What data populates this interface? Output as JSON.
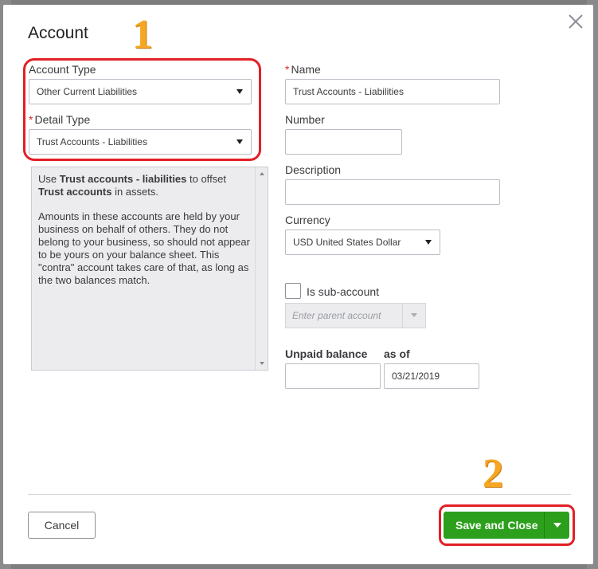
{
  "dialog": {
    "title": "Account",
    "close_icon": "close-icon"
  },
  "annotations": {
    "step1": "1",
    "step2": "2",
    "highlight_color": "#e21f26",
    "number_color": "#f6a623"
  },
  "form": {
    "account_type": {
      "label": "Account Type",
      "value": "Other Current Liabilities"
    },
    "detail_type": {
      "required_mark": "*",
      "label": "Detail Type",
      "value": "Trust Accounts - Liabilities"
    },
    "description_help": {
      "p1_before": "Use ",
      "p1_bold1": "Trust accounts - liabilities",
      "p1_mid": " to offset ",
      "p1_bold2": "Trust accounts",
      "p1_after": " in assets.",
      "p2": "Amounts in these accounts are held by your business on behalf of others. They do not belong to your business, so should not appear to be yours on your balance sheet. This \"contra\" account takes care of that, as long as the two balances match."
    },
    "name": {
      "required_mark": "*",
      "label": "Name",
      "value": "Trust Accounts - Liabilities"
    },
    "number": {
      "label": "Number",
      "value": ""
    },
    "description": {
      "label": "Description",
      "value": ""
    },
    "currency": {
      "label": "Currency",
      "value": "USD United States Dollar"
    },
    "sub_account": {
      "label": "Is sub-account",
      "checked": false,
      "parent_placeholder": "Enter parent account"
    },
    "unpaid_balance": {
      "label": "Unpaid balance",
      "value": ""
    },
    "as_of": {
      "label": "as of",
      "value": "03/21/2019"
    }
  },
  "footer": {
    "cancel_label": "Cancel",
    "save_label": "Save and Close",
    "save_color": "#2ca01c"
  }
}
